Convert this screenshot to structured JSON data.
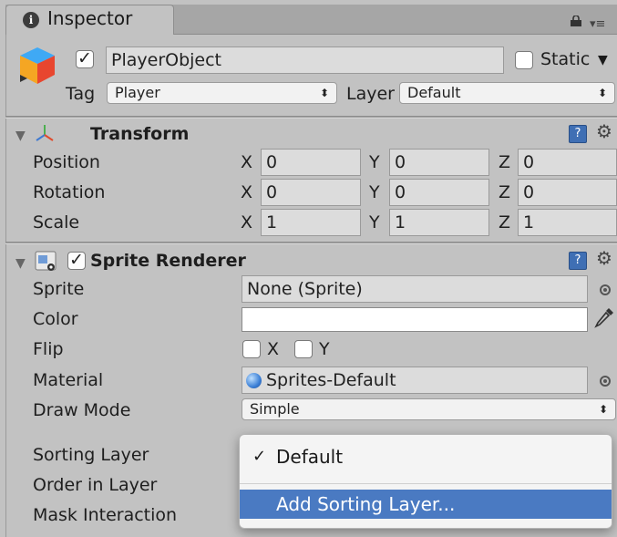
{
  "tab": {
    "icon": "info-icon",
    "icon_glyph": "i",
    "label": "Inspector"
  },
  "tab_actions": {
    "lock": "lock-icon",
    "menu": "tab-menu-icon",
    "menu_glyph": "▾≡"
  },
  "game_object": {
    "active": true,
    "name": "PlayerObject",
    "static_label": "Static",
    "static_checked": false,
    "tag_label": "Tag",
    "tag_value": "Player",
    "layer_label": "Layer",
    "layer_value": "Default"
  },
  "transform": {
    "title": "Transform",
    "rows": [
      {
        "label": "Position",
        "x": "0",
        "y": "0",
        "z": "0"
      },
      {
        "label": "Rotation",
        "x": "0",
        "y": "0",
        "z": "0"
      },
      {
        "label": "Scale",
        "x": "1",
        "y": "1",
        "z": "1"
      }
    ],
    "axis_x": "X",
    "axis_y": "Y",
    "axis_z": "Z"
  },
  "sprite_renderer": {
    "title": "Sprite Renderer",
    "enabled": true,
    "sprite_label": "Sprite",
    "sprite_value": "None (Sprite)",
    "color_label": "Color",
    "color_value": "#ffffff",
    "flip_label": "Flip",
    "flip_x": "X",
    "flip_y": "Y",
    "material_label": "Material",
    "material_value": "Sprites-Default",
    "draw_mode_label": "Draw Mode",
    "draw_mode_value": "Simple",
    "sorting_layer_label": "Sorting Layer",
    "order_label": "Order in Layer",
    "mask_label": "Mask Interaction"
  },
  "sorting_dropdown": {
    "items": [
      {
        "label": "Default",
        "checked": true,
        "check_glyph": "✓"
      },
      {
        "label": "Add Sorting Layer...",
        "highlighted": true
      }
    ]
  },
  "colors": {
    "highlight": "#4a7ac2",
    "panel": "#c2c2c2",
    "help_icon": "#3f6fb4"
  }
}
